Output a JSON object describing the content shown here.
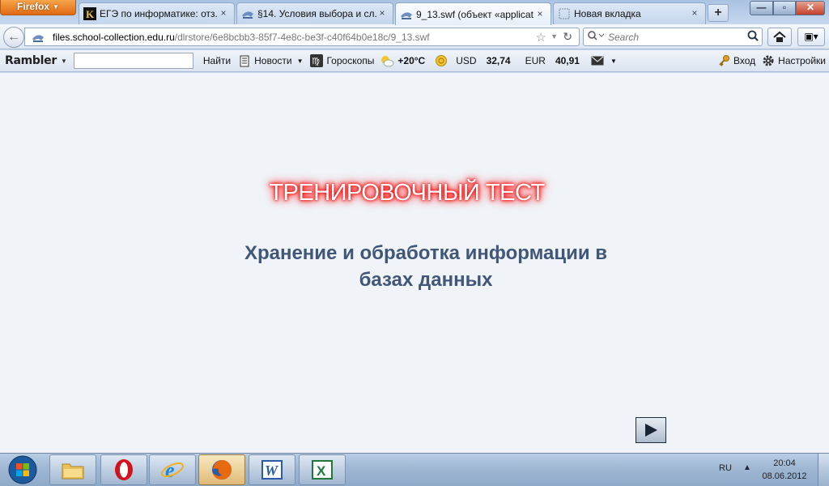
{
  "browser": {
    "menu_button": "Firefox",
    "tabs": [
      {
        "label": "ЕГЭ по информатике: отз...",
        "close": "×"
      },
      {
        "label": "§14. Условия выбора и сл...",
        "close": "×"
      },
      {
        "label": "9_13.swf (объект «applicat...",
        "close": "×"
      },
      {
        "label": "Новая вкладка",
        "close": "×"
      }
    ],
    "new_tab": "+",
    "window": {
      "minimize": "—",
      "maximize": "▫",
      "close": "✕"
    }
  },
  "navigation": {
    "url_host": "files.school-collection.edu.ru",
    "url_path": "/dlrstore/6e8bcbb3-85f7-4e8c-be3f-c40f64b0e18c/9_13.swf",
    "search_placeholder": "Search"
  },
  "rambler": {
    "logo": "Rambler",
    "find": "Найти",
    "news": "Новости",
    "horoscopes": "Гороскопы",
    "temperature": "+20°C",
    "usd_label": "USD",
    "usd_value": "32,74",
    "eur_label": "EUR",
    "eur_value": "40,91",
    "login": "Вход",
    "settings": "Настройки"
  },
  "content": {
    "title": "ТРЕНИРОВОЧНЫЙ ТЕСТ",
    "subtitle_line1": "Хранение и обработка информации в",
    "subtitle_line2": "базах данных"
  },
  "taskbar": {
    "language": "RU",
    "time": "20:04",
    "date": "08.06.2012"
  }
}
